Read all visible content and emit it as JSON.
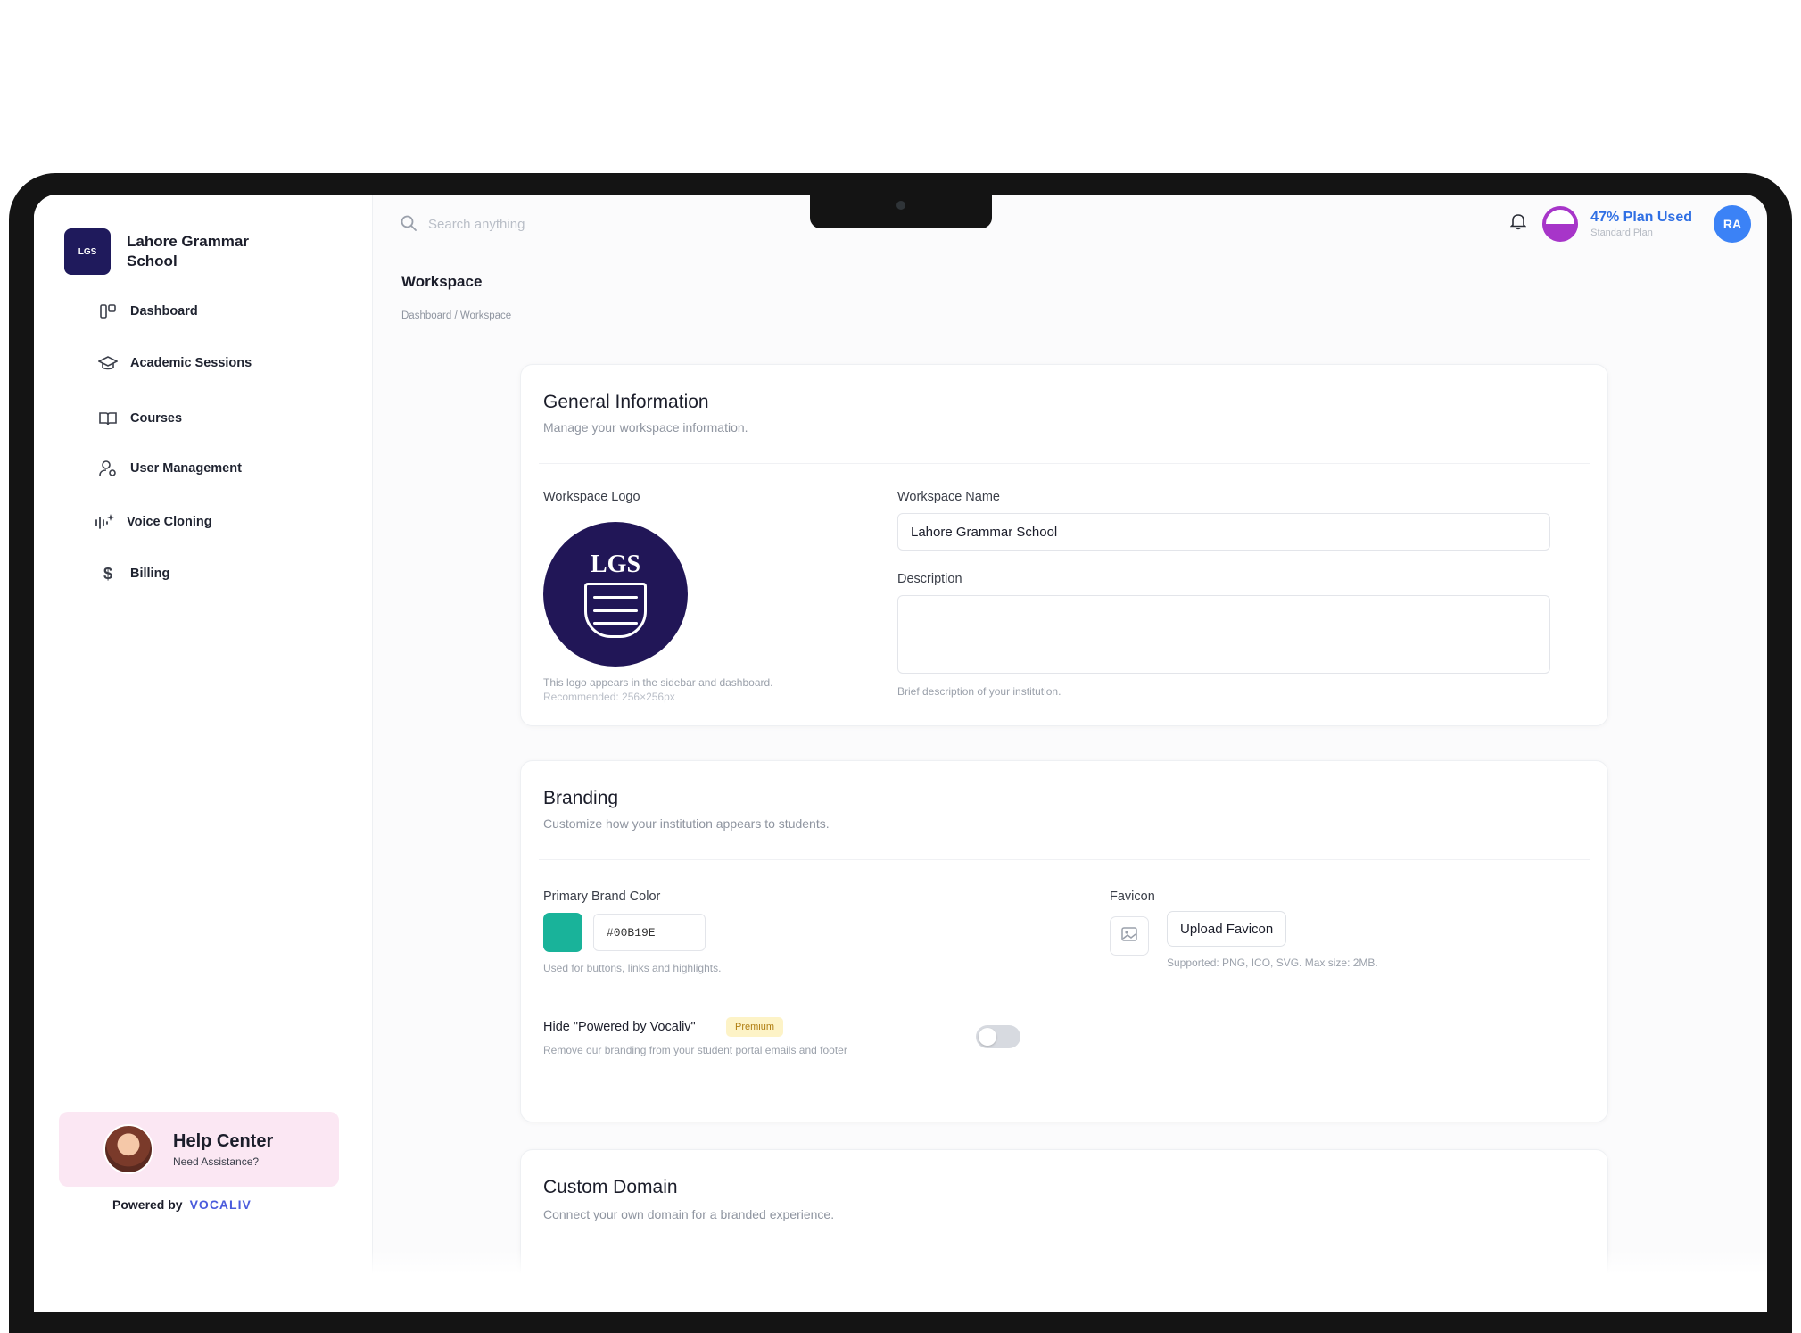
{
  "brand": {
    "name": "Lahore Grammar School",
    "logo_text": "LGS"
  },
  "sidebar": {
    "items": [
      {
        "label": "Dashboard",
        "icon": "dashboard-icon"
      },
      {
        "label": "Academic Sessions",
        "icon": "graduation-cap-icon"
      },
      {
        "label": "Courses",
        "icon": "book-icon"
      },
      {
        "label": "User Management",
        "icon": "user-settings-icon"
      },
      {
        "label": "Voice Cloning",
        "icon": "voice-wave-icon"
      },
      {
        "label": "Billing",
        "icon": "dollar-icon"
      }
    ],
    "help": {
      "title": "Help Center",
      "subtitle": "Need Assistance?"
    },
    "powered_by": "Powered by",
    "powered_brand": "VOCALIV"
  },
  "topbar": {
    "search_placeholder": "Search anything",
    "plan_title": "47% Plan Used",
    "plan_subtitle": "Standard Plan",
    "plan_used_percent": 47,
    "avatar_initials": "RA"
  },
  "page": {
    "title": "Workspace",
    "breadcrumb": "Dashboard / Workspace"
  },
  "general": {
    "title": "General Information",
    "description": "Manage your workspace information.",
    "logo_label": "Workspace Logo",
    "logo_hint_1": "This logo appears in the sidebar and dashboard.",
    "logo_hint_2": "Recommended: 256×256px",
    "name_label": "Workspace Name",
    "name_value": "Lahore Grammar School",
    "desc_label": "Description",
    "desc_hint": "Brief description of your institution."
  },
  "branding": {
    "title": "Branding",
    "description": "Customize how your institution appears to students.",
    "color_label": "Primary Brand Color",
    "color_value": "#00B19E",
    "color_swatch": "#19b39a",
    "color_hint": "Used for buttons, links and highlights.",
    "favicon_label": "Favicon",
    "upload_label": "Upload Favicon",
    "favicon_hint": "Supported: PNG, ICO, SVG. Max size: 2MB.",
    "hide_label": "Hide \"Powered by Vocaliv\"",
    "premium_badge": "Premium",
    "hide_hint": "Remove our branding from your student portal emails and footer",
    "hide_enabled": false
  },
  "domain": {
    "title": "Custom Domain",
    "description": "Connect your own domain for a branded experience."
  }
}
